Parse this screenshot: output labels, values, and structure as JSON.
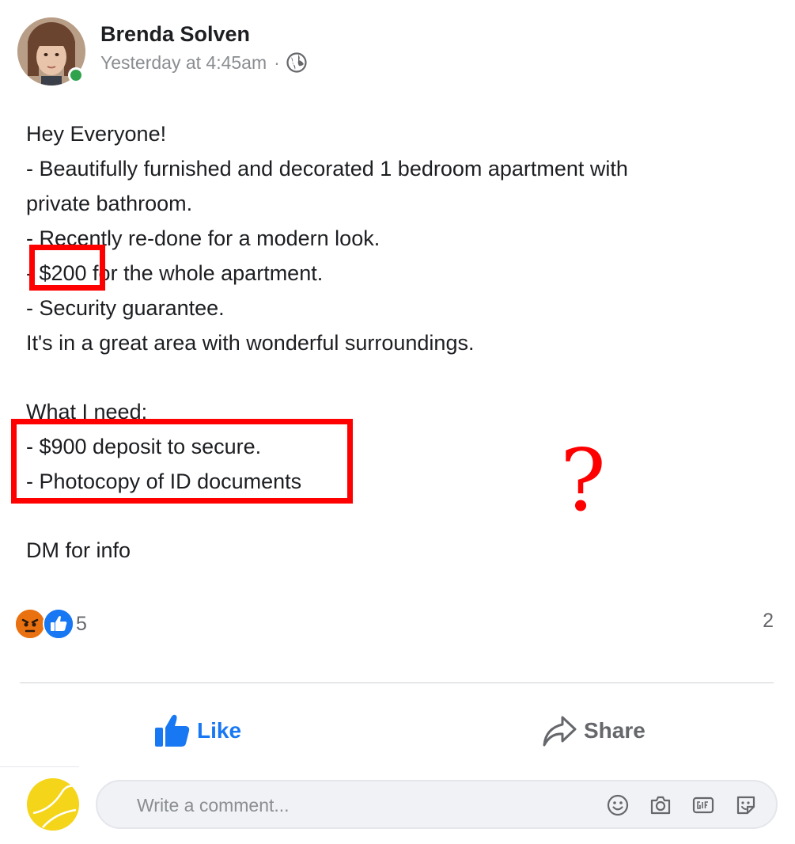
{
  "author": {
    "name": "Brenda Solven",
    "timestamp": "Yesterday at 4:45am",
    "separator": "·",
    "audience_icon": "globe-icon",
    "online": true
  },
  "post": {
    "lines": [
      "Hey Everyone!",
      "- Beautifully furnished and decorated 1 bedroom apartment with",
      "private bathroom.",
      "- Recently re-done for a modern look.",
      "- $200 for the whole apartment.",
      "- Security guarantee.",
      "It's in a great area with wonderful surroundings.",
      "",
      "What I need:",
      "- $900 deposit to secure.",
      "- Photocopy of ID documents",
      "",
      "DM for info"
    ]
  },
  "annotations": {
    "question_mark": "?",
    "color": "#ff0000"
  },
  "reactions": {
    "types": [
      "angry-reaction-icon",
      "like-reaction-icon"
    ],
    "count": "5",
    "comment_count": "2"
  },
  "actions": {
    "like_label": "Like",
    "share_label": "Share"
  },
  "composer": {
    "placeholder": "Write a comment...",
    "icons": [
      "emoji-icon",
      "camera-icon",
      "gif-icon",
      "sticker-icon"
    ]
  },
  "colors": {
    "brand_blue": "#1877f2",
    "online_green": "#31a24c",
    "angry_orange": "#e9710f",
    "secondary_text": "#65676b"
  }
}
